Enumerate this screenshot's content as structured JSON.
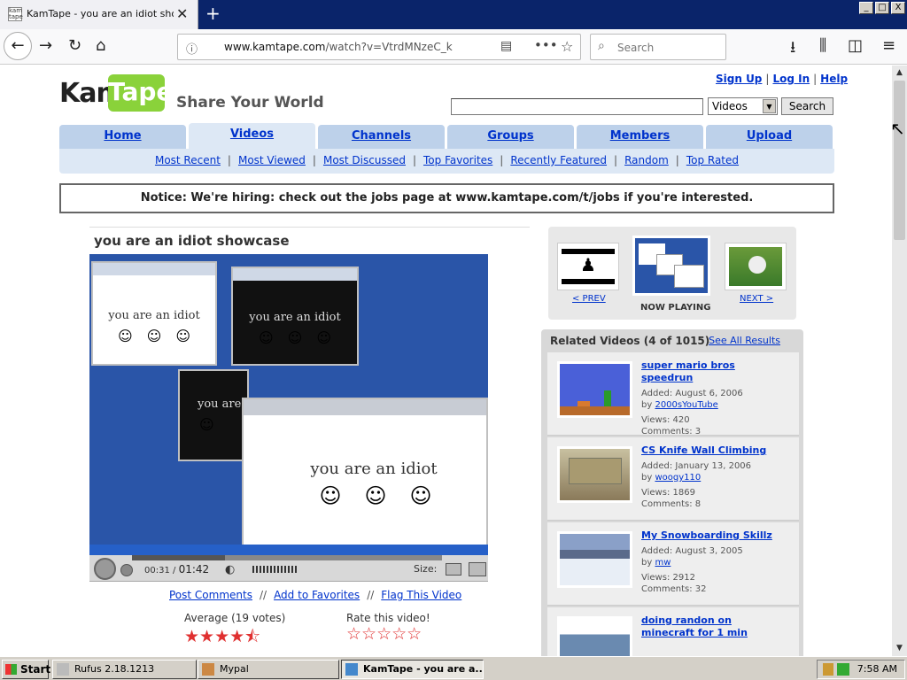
{
  "browser": {
    "tab_title": "KamTape - you are an idiot showcase",
    "favicon_text": "kam tape",
    "new_tab": "+",
    "url_host": "www.kamtape.com",
    "url_path": "/watch?v=VtrdMNzeC_k",
    "search_placeholder": "Search",
    "window_buttons": [
      "_",
      "□",
      "X"
    ]
  },
  "site": {
    "logo_kam": "Kam",
    "logo_tape": "Tape",
    "tagline": "Share Your World",
    "top_links": [
      "Sign Up",
      "Log In",
      "Help"
    ],
    "search_category": "Videos",
    "search_button": "Search",
    "main_tabs": [
      "Home",
      "Videos",
      "Channels",
      "Groups",
      "Members",
      "Upload"
    ],
    "active_tab": "Videos",
    "sub_nav": [
      "Most Recent",
      "Most Viewed",
      "Most Discussed",
      "Top Favorites",
      "Recently Featured",
      "Random",
      "Top Rated"
    ],
    "notice": "Notice: We're hiring: check out the jobs page at www.kamtape.com/t/jobs if you're interested."
  },
  "video": {
    "title": "you are an idiot showcase",
    "frame_text": "you are an idiot",
    "frame_text_partial": "you are",
    "time_current": "00:31",
    "time_total": "01:42",
    "progress_fraction": 0.3,
    "size_label": "Size:",
    "actions": [
      "Post Comments",
      "Add to Favorites",
      "Flag This Video"
    ],
    "average_label": "Average (19 votes)",
    "average_rating": 4.5,
    "rate_label": "Rate this video!",
    "stars_filled": "★★★★⯪",
    "stars_empty": "☆☆☆☆☆"
  },
  "navigator": {
    "prev": "< PREV",
    "now_playing": "NOW PLAYING",
    "next": "NEXT >"
  },
  "related": {
    "header": "Related Videos (4 of 1015)",
    "see_all": "See All Results",
    "items": [
      {
        "title": "super mario bros speedrun",
        "added": "Added: August 6, 2006",
        "by_label": "by",
        "by": "2000sYouTube",
        "views": "Views: 420",
        "comments": "Comments: 3"
      },
      {
        "title": "CS Knife Wall Climbing",
        "added": "Added: January 13, 2006",
        "by_label": "by",
        "by": "woogy110",
        "views": "Views: 1869",
        "comments": "Comments: 8"
      },
      {
        "title": "My Snowboarding Skillz",
        "added": "Added: August 3, 2005",
        "by_label": "by",
        "by": "mw",
        "views": "Views: 2912",
        "comments": "Comments: 32"
      },
      {
        "title": "doing randon on minecraft for 1 min"
      }
    ]
  },
  "taskbar": {
    "start": "Start",
    "items": [
      "Rufus 2.18.1213",
      "Mypal",
      "KamTape - you are a..."
    ],
    "clock": "7:58 AM"
  }
}
